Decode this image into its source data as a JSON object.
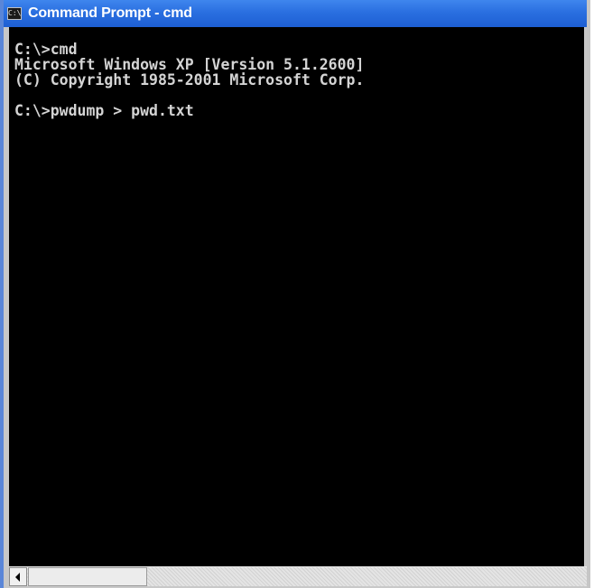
{
  "window": {
    "title": "Command Prompt - cmd",
    "icon_label": "C:\\"
  },
  "console": {
    "lines": [
      "C:\\>cmd",
      "Microsoft Windows XP [Version 5.1.2600]",
      "(C) Copyright 1985-2001 Microsoft Corp.",
      "",
      "C:\\>pwdump > pwd.txt"
    ]
  },
  "scrollbar": {
    "left_arrow_icon": "arrow-left-icon"
  }
}
